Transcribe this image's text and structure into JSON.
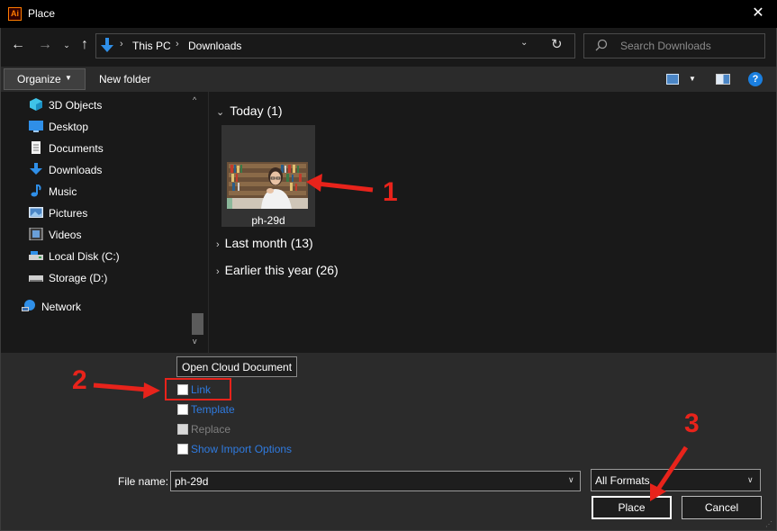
{
  "window": {
    "title": "Place",
    "app_icon": "Ai"
  },
  "nav": {
    "breadcrumb": [
      "This PC",
      "Downloads"
    ],
    "search_placeholder": "Search Downloads"
  },
  "toolbar": {
    "organize": "Organize",
    "new_folder": "New folder"
  },
  "sidebar": {
    "items": [
      {
        "label": "3D Objects",
        "icon": "3d-objects-icon"
      },
      {
        "label": "Desktop",
        "icon": "desktop-icon"
      },
      {
        "label": "Documents",
        "icon": "documents-icon"
      },
      {
        "label": "Downloads",
        "icon": "downloads-icon"
      },
      {
        "label": "Music",
        "icon": "music-icon"
      },
      {
        "label": "Pictures",
        "icon": "pictures-icon"
      },
      {
        "label": "Videos",
        "icon": "videos-icon"
      },
      {
        "label": "Local Disk (C:)",
        "icon": "local-disk-icon"
      },
      {
        "label": "Storage (D:)",
        "icon": "storage-drive-icon"
      },
      {
        "label": "Network",
        "icon": "network-icon"
      }
    ]
  },
  "content": {
    "groups": [
      {
        "label": "Today (1)",
        "expanded": true
      },
      {
        "label": "Last month (13)",
        "expanded": false
      },
      {
        "label": "Earlier this year (26)",
        "expanded": false
      }
    ],
    "file": {
      "name": "ph-29d"
    }
  },
  "options": {
    "tooltip": "Open Cloud Document",
    "checkboxes": [
      {
        "label": "Link",
        "enabled": true
      },
      {
        "label": "Template",
        "enabled": true
      },
      {
        "label": "Replace",
        "enabled": false
      },
      {
        "label": "Show Import Options",
        "enabled": true
      }
    ]
  },
  "footer": {
    "file_name_label": "File name:",
    "file_name_value": "ph-29d",
    "format": "All Formats",
    "place_button": "Place",
    "cancel_button": "Cancel"
  },
  "annotations": {
    "n1": "1",
    "n2": "2",
    "n3": "3",
    "color": "#e8231b"
  }
}
